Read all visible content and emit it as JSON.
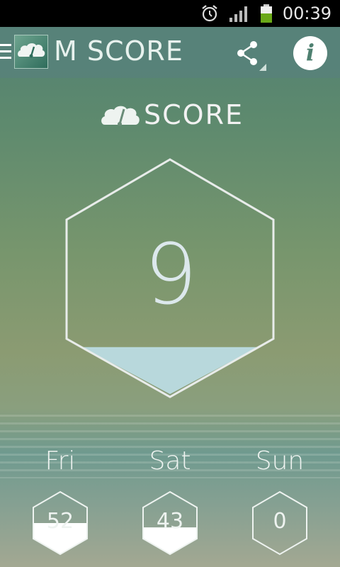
{
  "status_bar": {
    "time": "00:39",
    "icons": [
      "alarm-icon",
      "signal-icon",
      "battery-icon"
    ]
  },
  "action_bar": {
    "title": "M SCORE",
    "icons": [
      "menu-icon",
      "brain-gauge-icon",
      "share-icon",
      "info-icon"
    ]
  },
  "logo": {
    "text": "SCORE",
    "icon": "brain-gauge-icon"
  },
  "main_score": {
    "value": "9",
    "fill_fraction": 0.2,
    "fill_color": "#b8d8dc"
  },
  "days": [
    {
      "label": "Fri",
      "value": "52",
      "fill_fraction": 0.5
    },
    {
      "label": "Sat",
      "value": "43",
      "fill_fraction": 0.43
    },
    {
      "label": "Sun",
      "value": "0",
      "fill_fraction": 0
    }
  ],
  "colors": {
    "action_bar": "#58827a",
    "accent_fill": "#b8d8dc",
    "outline": "#e8ecea"
  }
}
